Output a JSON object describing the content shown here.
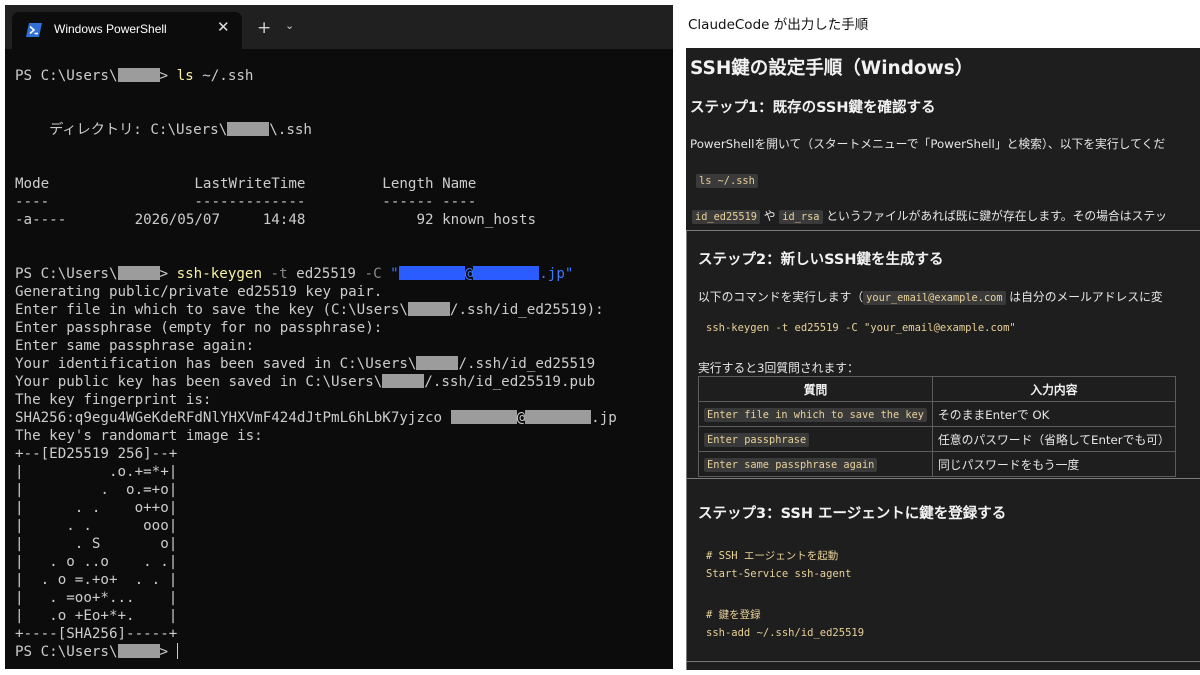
{
  "terminal": {
    "tab_title": "Windows PowerShell",
    "close_glyph": "✕",
    "new_tab_glyph": "+",
    "menu_glyph": "⌄",
    "lines": {
      "l1_prompt": "PS C:\\Users\\",
      "l1_gt": "> ",
      "l1_cmd": "ls",
      "l1_arg": " ~/.ssh",
      "dir_label": "    ディレクトリ: C:\\Users\\",
      "dir_suffix": "\\.ssh",
      "header": "Mode                 LastWriteTime         Length Name",
      "dashes": "----                 -------------         ------ ----",
      "row": "-a----        2026/05/07     14:48             92 known_hosts",
      "l2_prompt": "PS C:\\Users\\",
      "l2_gt": "> ",
      "l2_cmd": "ssh-keygen",
      "l2_flag1": " -t",
      "l2_arg1": " ed25519",
      "l2_flag2": " -C",
      "l2_q1": " \"",
      "l2_at": "@",
      "l2_q2": ".jp\"",
      "gen": "Generating public/private ed25519 key pair.",
      "enter_file_a": "Enter file in which to save the key (C:\\Users\\",
      "enter_file_b": "/.ssh/id_ed25519):",
      "pass1": "Enter passphrase (empty for no passphrase):",
      "pass2": "Enter same passphrase again:",
      "ident_a": "Your identification has been saved in C:\\Users\\",
      "ident_b": "/.ssh/id_ed25519",
      "pub_a": "Your public key has been saved in C:\\Users\\",
      "pub_b": "/.ssh/id_ed25519.pub",
      "fp_label": "The key fingerprint is:",
      "fp_value": "SHA256:q9egu4WGeKdeRFdNlYHXVmF424dJtPmL6hLbK7yjzco ",
      "fp_at": "@",
      "fp_jp": ".jp",
      "randomart_label": "The key's randomart image is:",
      "art": [
        "+--[ED25519 256]--+",
        "|          .o.+=*+|",
        "|         .  o.=+o|",
        "|      . .    o++o|",
        "|     . .      ooo|",
        "|      . S       o|",
        "|   . o ..o    . .|",
        "|  . o =.+o+  . . |",
        "|   . =oo+*...    |",
        "|   .o +Eo+*+.    |",
        "+----[SHA256]-----+"
      ],
      "final_prompt": "PS C:\\Users\\",
      "final_gt": "> "
    }
  },
  "caption": "ClaudeCode が出力した手順",
  "doc": {
    "title": "SSH鍵の設定手順（Windows）",
    "step1": {
      "heading": "ステップ1：既存のSSH鍵を確認する",
      "para": "PowerShellを開いて（スタートメニューで「PowerShell」と検索）、以下を実行してくだ",
      "code": "ls ~/.ssh",
      "note_code1": "id_ed25519",
      "note_mid1": " や ",
      "note_code2": "id_rsa",
      "note_rest": " というファイルがあれば既に鍵が存在します。その場合はステッ"
    },
    "step2": {
      "heading": "ステップ2：新しいSSH鍵を生成する",
      "para_a": "以下のコマンドを実行します（",
      "para_code": "your_email@example.com",
      "para_b": " は自分のメールアドレスに変",
      "code": "ssh-keygen -t ed25519 -C \"your_email@example.com\"",
      "questions_intro": "実行すると3回質問されます：",
      "table": {
        "headers": [
          "質問",
          "入力内容"
        ],
        "rows": [
          {
            "q": "Enter file in which to save the key",
            "a": "そのままEnterで OK"
          },
          {
            "q": "Enter passphrase",
            "a": "任意のパスワード（省略してEnterでも可）"
          },
          {
            "q": "Enter same passphrase again",
            "a": "同じパスワードをもう一度"
          }
        ]
      }
    },
    "step3": {
      "heading": "ステップ3：SSH エージェントに鍵を登録する",
      "code_lines": [
        "# SSH エージェントを起動",
        "Start-Service ssh-agent",
        "",
        "# 鍵を登録",
        "ssh-add ~/.ssh/id_ed25519"
      ]
    }
  },
  "colors": {
    "terminal_bg": "#0c0c0c",
    "tabbar_bg": "#202020",
    "command_yellow": "#f9f1a5",
    "flag_gray": "#8a8a8a",
    "string_blue": "#3b78ff",
    "doc_bg": "#1e1e1e",
    "code_gold": "#e8d29a"
  },
  "icons": {
    "tab_icon": "powershell-icon"
  }
}
